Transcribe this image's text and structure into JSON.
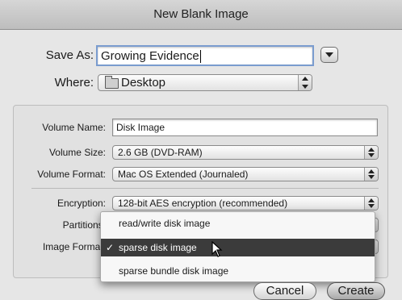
{
  "window": {
    "title": "New Blank Image"
  },
  "save_as": {
    "label": "Save As:",
    "value": "Growing Evidence"
  },
  "where": {
    "label": "Where:",
    "value": "Desktop",
    "icon": "folder-icon"
  },
  "volume_name": {
    "label": "Volume Name:",
    "value": "Disk Image"
  },
  "volume_size": {
    "label": "Volume Size:",
    "value": "2.6 GB (DVD-RAM)"
  },
  "volume_format": {
    "label": "Volume Format:",
    "value": "Mac OS Extended (Journaled)"
  },
  "encryption": {
    "label": "Encryption:",
    "value": "128-bit AES encryption (recommended)"
  },
  "partitions": {
    "label": "Partitions:"
  },
  "image_format": {
    "label": "Image Format:",
    "menu": [
      {
        "label": "read/write disk image",
        "selected": false
      },
      {
        "label": "sparse disk image",
        "selected": true
      },
      {
        "label": "sparse bundle disk image",
        "selected": false
      }
    ],
    "check_glyph": "✓"
  },
  "buttons": {
    "cancel": "Cancel",
    "create": "Create"
  }
}
